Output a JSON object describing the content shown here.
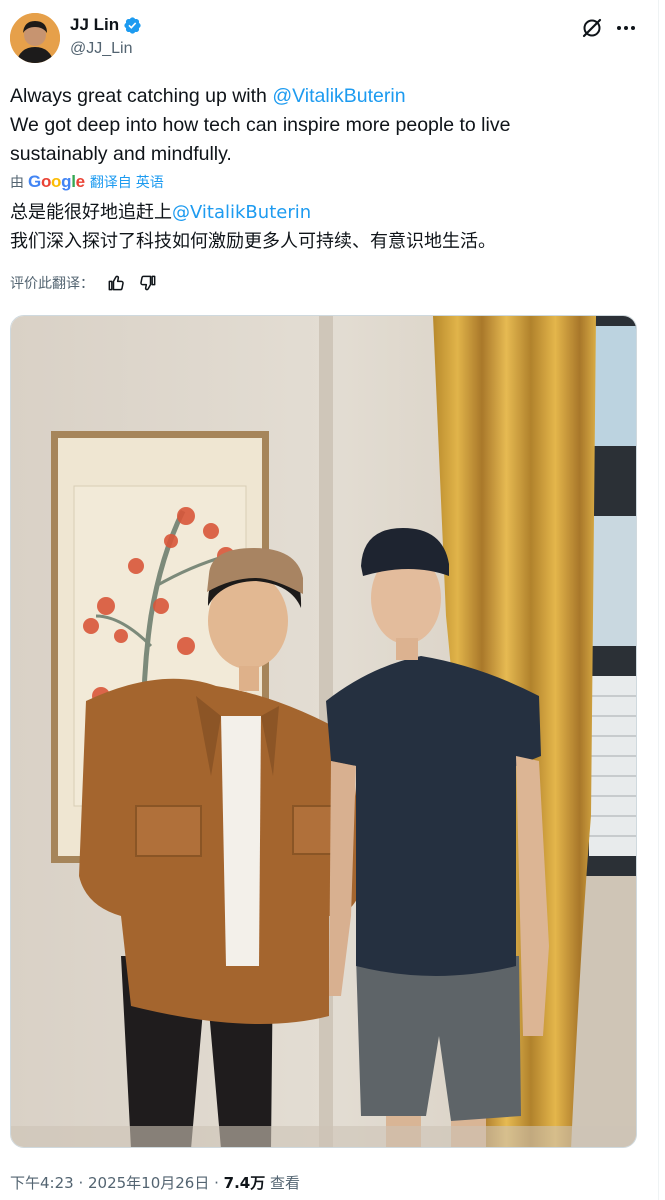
{
  "author": {
    "display_name": "JJ Lin",
    "handle": "@JJ_Lin",
    "verified": true,
    "verified_color": "#1d9bf0"
  },
  "header_icons": [
    "grok-icon",
    "more-icon"
  ],
  "tweet": {
    "text_prefix": "Always great catching up with ",
    "mention": "@VitalikButerin",
    "line2": "We got deep into how tech can inspire more people to live",
    "line3": "sustainably and mindfully."
  },
  "translation": {
    "by_label": "由",
    "google_letters": [
      "G",
      "o",
      "o",
      "g",
      "l",
      "e"
    ],
    "translated_from": "翻译自 英语",
    "line1_prefix": "总是能很好地追赶上",
    "line1_mention": "@VitalikButerin",
    "line2": "我们深入探讨了科技如何激励更多人可持续、有意识地生活。",
    "rate_label": "评价此翻译："
  },
  "meta": {
    "time": "下午4:23",
    "date": "2025年10月26日",
    "separator": " · ",
    "views": "7.4万",
    "views_label": "查看"
  },
  "colors": {
    "link": "#1d9bf0",
    "secondary_text": "#536471",
    "primary_text": "#0f1419"
  }
}
